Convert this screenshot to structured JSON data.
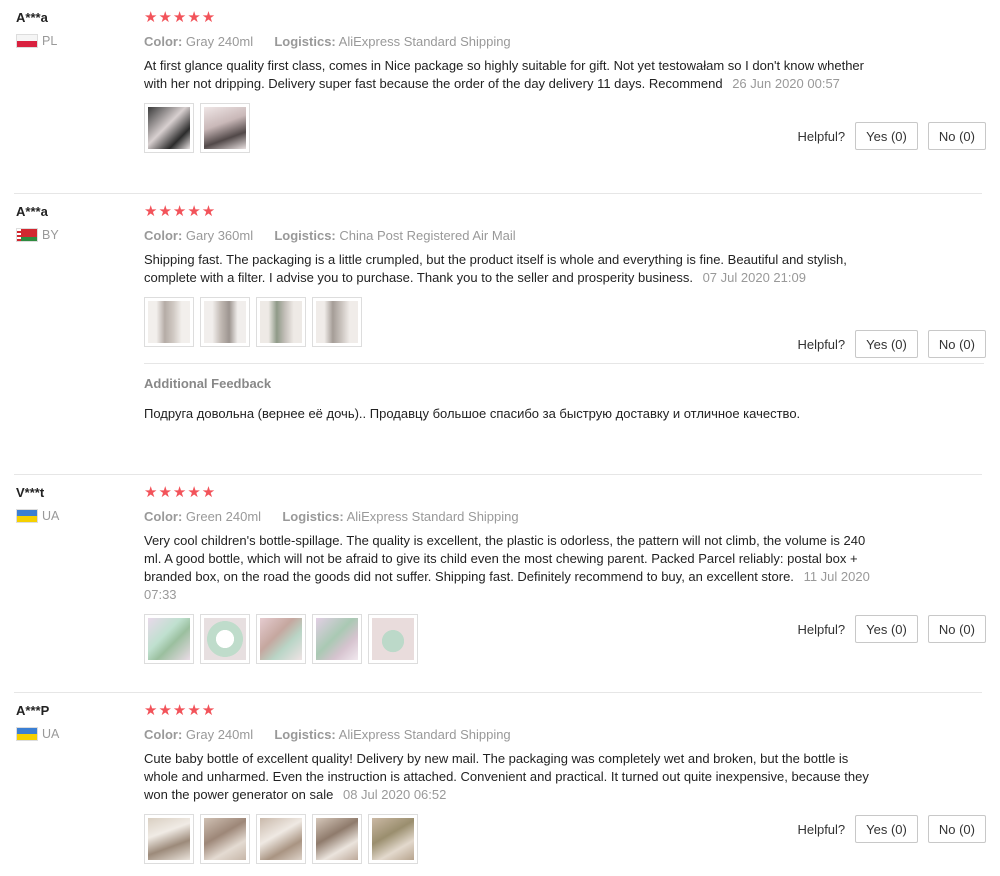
{
  "reviews": [
    {
      "user": "A***a",
      "country_code": "PL",
      "stars": "★★★★★",
      "color_label": "Color:",
      "color_value": "Gray 240ml",
      "logistics_label": "Logistics:",
      "logistics_value": "AliExpress Standard Shipping",
      "text": "At first glance quality first class, comes in Nice package so highly suitable for gift. Not yet testowałam so I don't know whether with her not dripping. Delivery super fast because the order of the day delivery 11 days. Recommend",
      "date": "26 Jun 2020 00:57",
      "helpful_label": "Helpful?",
      "yes_label": "Yes (0)",
      "no_label": "No (0)"
    },
    {
      "user": "A***a",
      "country_code": "BY",
      "stars": "★★★★★",
      "color_label": "Color:",
      "color_value": "Gary 360ml",
      "logistics_label": "Logistics:",
      "logistics_value": "China Post Registered Air Mail",
      "text": "Shipping fast. The packaging is a little crumpled, but the product itself is whole and everything is fine. Beautiful and stylish, complete with a filter. I advise you to purchase. Thank you to the seller and prosperity business.",
      "date": "07 Jul 2020 21:09",
      "helpful_label": "Helpful?",
      "yes_label": "Yes (0)",
      "no_label": "No (0)",
      "additional_title": "Additional Feedback",
      "additional_text": "Подруга довольна (вернее её дочь).. Продавцу большое спасибо за быструю доставку и отличное качество."
    },
    {
      "user": "V***t",
      "country_code": "UA",
      "stars": "★★★★★",
      "color_label": "Color:",
      "color_value": "Green 240ml",
      "logistics_label": "Logistics:",
      "logistics_value": "AliExpress Standard Shipping",
      "text": "Very cool children's bottle-spillage. The quality is excellent, the plastic is odorless, the pattern will not climb, the volume is 240 ml. A good bottle, which will not be afraid to give its child even the most chewing parent. Packed Parcel reliably: postal box + branded box, on the road the goods did not suffer. Shipping fast. Definitely recommend to buy, an excellent store.",
      "date": "11 Jul 2020 07:33",
      "helpful_label": "Helpful?",
      "yes_label": "Yes (0)",
      "no_label": "No (0)"
    },
    {
      "user": "A***P",
      "country_code": "UA",
      "stars": "★★★★★",
      "color_label": "Color:",
      "color_value": "Gray 240ml",
      "logistics_label": "Logistics:",
      "logistics_value": "AliExpress Standard Shipping",
      "text": "Cute baby bottle of excellent quality! Delivery by new mail. The packaging was completely wet and broken, but the bottle is whole and unharmed. Even the instruction is attached. Convenient and practical. It turned out quite inexpensive, because they won the power generator on sale",
      "date": "08 Jul 2020 06:52",
      "helpful_label": "Helpful?",
      "yes_label": "Yes (0)",
      "no_label": "No (0)"
    }
  ],
  "colors": {
    "star": "#f2535a",
    "muted": "#999999",
    "border": "#e6e6e6"
  }
}
